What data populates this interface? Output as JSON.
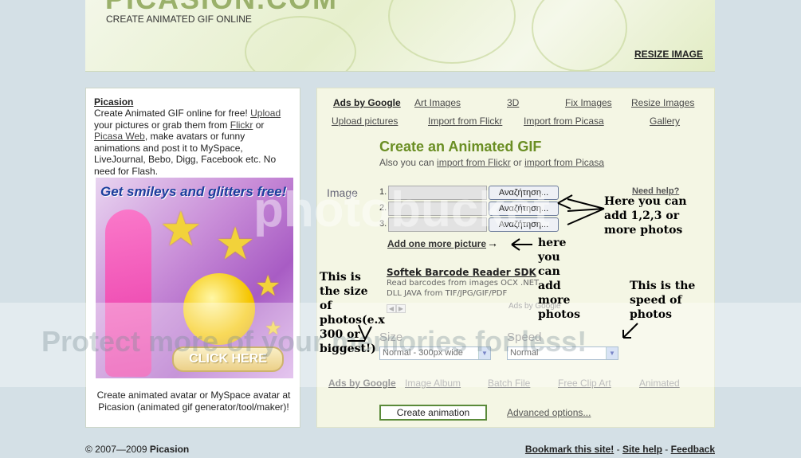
{
  "header": {
    "logo_text": "PICASION.COM",
    "tagline": "CREATE ANIMATED GIF ONLINE",
    "resize_link": "RESIZE IMAGE"
  },
  "sidebar": {
    "title": "Picasion",
    "desc_1": "Create Animated GIF online for free! ",
    "upload_link": "Upload",
    "desc_2": " your pictures or grab them from ",
    "flickr_link": "Flickr",
    "desc_3": " or ",
    "picasa_link": "Picasa Web",
    "desc_4": ", make avatars or funny animations and post it to MySpace, LiveJournal, Bebo, Digg, Facebook etc. No need for Flash.",
    "ad_headline": "Get smileys and glitters free!",
    "ad_button": "CLICK HERE",
    "footer_text": "Create animated avatar or MySpace avatar at Picasion (animated gif generator/tool/maker)!"
  },
  "nav_row1": [
    "Ads by Google",
    "Art Images",
    "3D",
    "Fix Images",
    "Resize Images"
  ],
  "nav_row2": [
    "Upload pictures",
    "Import from Flickr",
    "Import from Picasa",
    "Gallery"
  ],
  "main": {
    "title": "Create an Animated GIF",
    "also_prefix": "Also you can ",
    "also_flickr": "import from Flickr",
    "also_or": " or ",
    "also_picasa": "import from Picasa",
    "image_label": "Image",
    "need_help": "Need help?",
    "file_rows": [
      {
        "num": "1.",
        "browse": "Αναζήτηση..."
      },
      {
        "num": "2.",
        "browse": "Αναζήτηση..."
      },
      {
        "num": "3.",
        "browse": "Αναζήτηση..."
      }
    ],
    "add_more": "Add one more picture",
    "add_arrow": "→",
    "ad_title": "Softek Barcode Reader SDK",
    "ad_desc": "Read barcodes from images OCX .NET DLL JAVA from TIF/JPG/GIF/PDF",
    "ads_by_google": "Ads by Google",
    "size_label": "Size",
    "size_value": "Normal - 300px wide",
    "speed_label": "Speed",
    "speed_value": "Normal",
    "bottom_links": [
      "Ads by Google",
      "Image Album",
      "Batch File",
      "Free Clip Art",
      "Animated"
    ],
    "create_button": "Create animation",
    "advanced": "Advanced options..."
  },
  "annotations": {
    "photos_note": "Here you can add 1,2,3 or more photos",
    "more_note": "here you can add more photos",
    "size_note": "This is the size of photos(e.x 300 or biggest!)",
    "speed_note": "This is the speed of photos"
  },
  "watermark": {
    "logo": "photobucket",
    "protect": "Protect more of your memories for less!"
  },
  "footer": {
    "copyright": "© 2007—2009 ",
    "brand": "Picasion",
    "bookmark": "Bookmark this site!",
    "sep1": " - ",
    "help": "Site help",
    "sep2": " - ",
    "feedback": "Feedback"
  },
  "colors": {
    "background": "#d4e0e6",
    "accent_green": "#6a8e23",
    "panel_bg": "#f4f6e4"
  }
}
